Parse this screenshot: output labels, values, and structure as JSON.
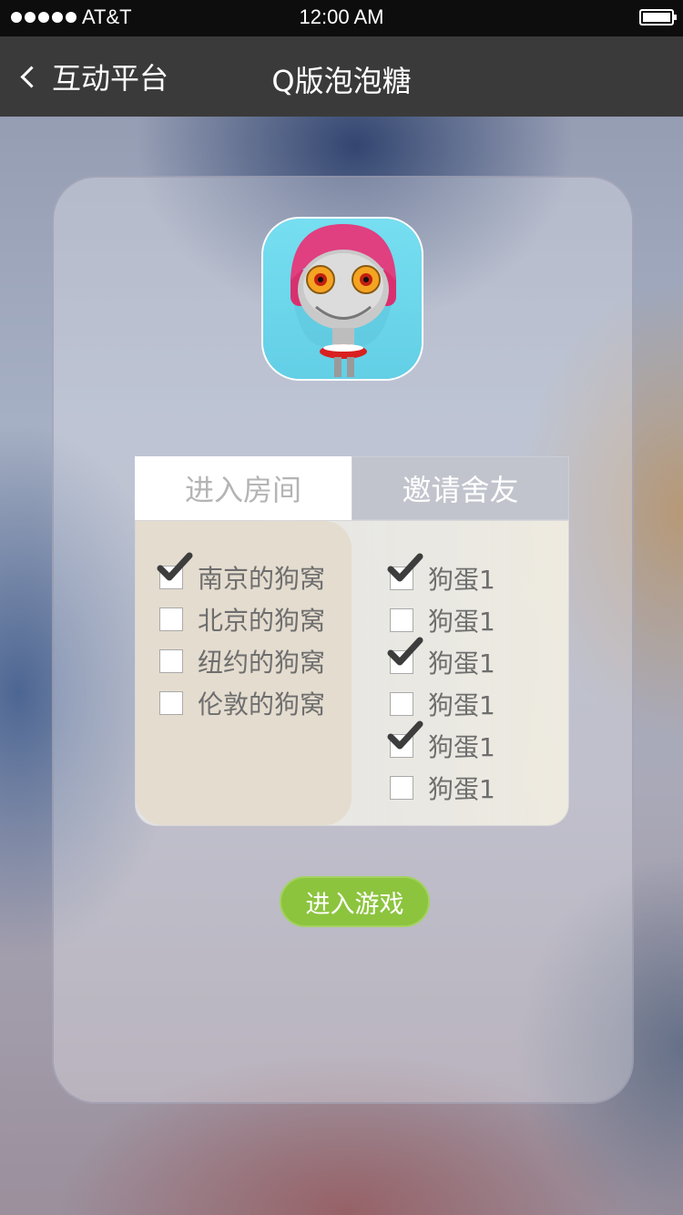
{
  "status_bar": {
    "carrier": "AT&T",
    "time": "12:00 AM",
    "signal_bars": 5,
    "battery_level": 1.0
  },
  "nav": {
    "back_label": "互动平台",
    "title": "Q版泡泡糖"
  },
  "tabs": [
    {
      "label": "进入房间",
      "active": true
    },
    {
      "label": "邀请舍友",
      "active": false
    }
  ],
  "rooms": [
    {
      "label": "南京的狗窝",
      "checked": true
    },
    {
      "label": "北京的狗窝",
      "checked": false
    },
    {
      "label": "纽约的狗窝",
      "checked": false
    },
    {
      "label": "伦敦的狗窝",
      "checked": false
    }
  ],
  "roommates": [
    {
      "label": "狗蛋1",
      "checked": true
    },
    {
      "label": "狗蛋1",
      "checked": false
    },
    {
      "label": "狗蛋1",
      "checked": true
    },
    {
      "label": "狗蛋1",
      "checked": false
    },
    {
      "label": "狗蛋1",
      "checked": true
    },
    {
      "label": "狗蛋1",
      "checked": false
    }
  ],
  "start_button": "进入游戏",
  "colors": {
    "status_bar_bg": "#0d0d0d",
    "nav_bg": "#3a3a3a",
    "accent_green": "#8cc43e",
    "checkmark": "#3d3d3d",
    "tab_inactive_bg": "#c1c4cc"
  },
  "icons": {
    "back": "chevron-left-icon",
    "app": "robot-mascot-icon",
    "check": "checkmark-icon"
  }
}
